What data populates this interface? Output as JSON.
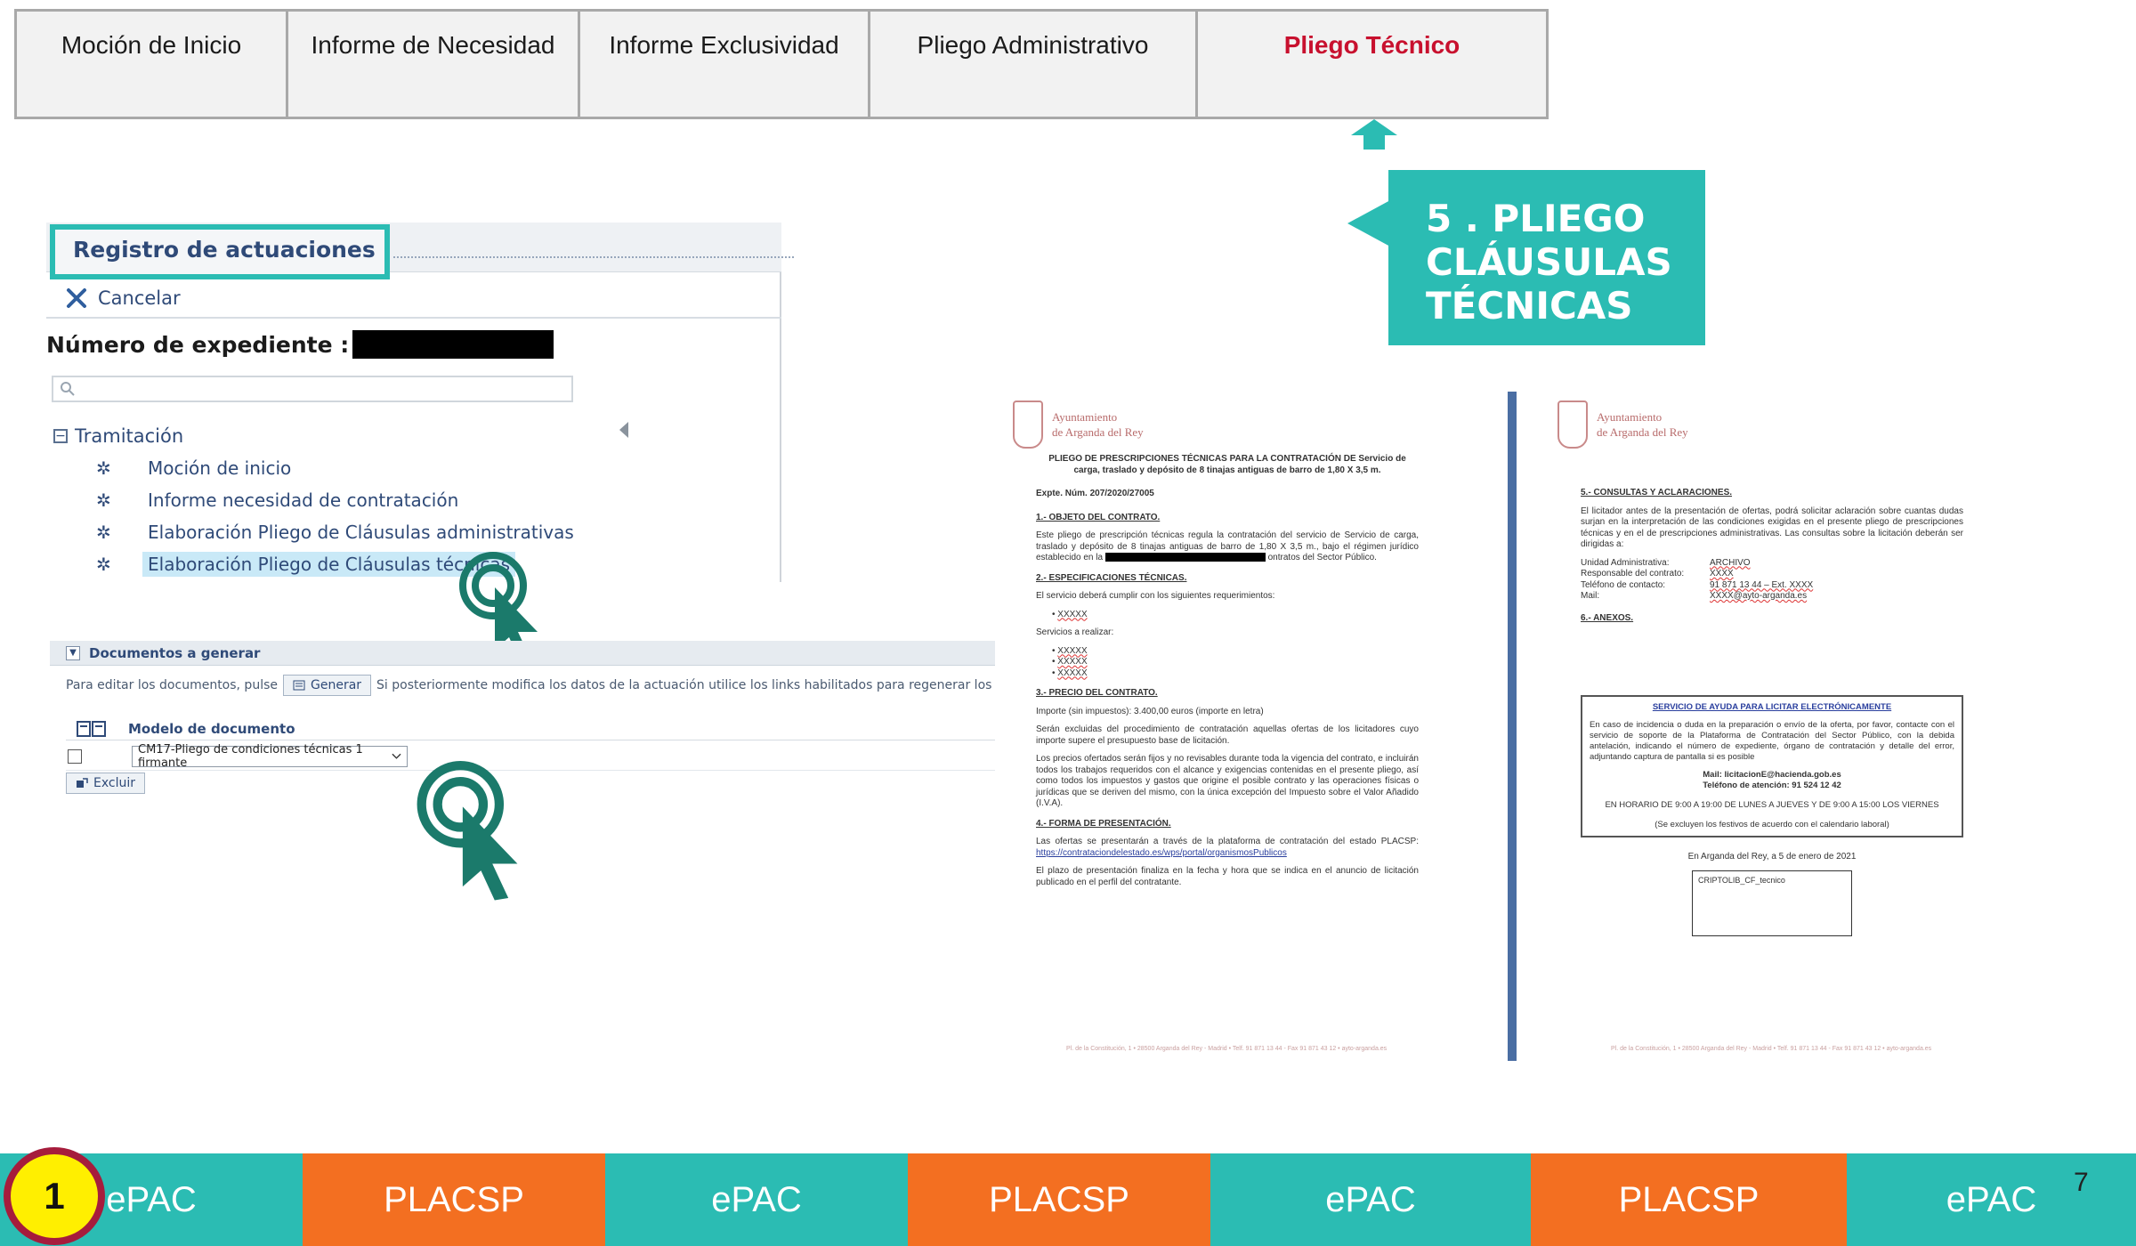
{
  "steps": [
    {
      "label": "Moción de Inicio",
      "active": false
    },
    {
      "label": "Informe de Necesidad",
      "active": false
    },
    {
      "label": "Informe Exclusividad",
      "active": false
    },
    {
      "label": "Pliego Administrativo",
      "active": false
    },
    {
      "label": "Pliego Técnico",
      "active": true
    }
  ],
  "callout": {
    "line1": "5 . PLIEGO",
    "line2": "CLÁUSULAS",
    "line3": "TÉCNICAS",
    "color": "#2bbcb3"
  },
  "registro": {
    "title": "Registro de actuaciones",
    "cancel_label": "Cancelar",
    "expediente_label": "Número de expediente :",
    "search_placeholder": "",
    "tree_root": "Tramitación",
    "tree_items": [
      {
        "label": "Moción de inicio"
      },
      {
        "label": "Informe necesidad de contratación"
      },
      {
        "label": "Elaboración Pliego de Cláusulas administrativas"
      },
      {
        "label": "Elaboración Pliego de Cláusulas técnicas",
        "selected": true
      }
    ]
  },
  "documentos": {
    "header": "Documentos a generar",
    "help_prefix": "Para editar los documentos, pulse",
    "generar_label": "Generar",
    "help_suffix": "Si posteriormente modifica los datos de la actuación utilice los links habilitados para regenerar los documentos",
    "column_header": "Modelo de documento",
    "selected_model": "CM17-Pliego de condiciones técnicas 1 firmante",
    "excluir_label": "Excluir"
  },
  "doc_left": {
    "org_line1": "Ayuntamiento",
    "org_line2": "de Arganda del Rey",
    "title": "PLIEGO DE PRESCRIPCIONES TÉCNICAS PARA LA CONTRATACIÓN DE Servicio de carga, traslado y depósito de 8 tinajas antiguas de barro de 1,80 X 3,5 m.",
    "expte": "Expte. Núm. 207/2020/27005",
    "s1": "1.- OBJETO DEL CONTRATO.",
    "s1_text_a": "Este pliego de prescripción técnicas regula la contratación del servicio de Servicio de carga, traslado y depósito de 8 tinajas antiguas de barro de 1,80 X 3,5 m., bajo el régimen jurídico establecido en la",
    "s1_text_b": "ontratos del Sector Público.",
    "s2": "2.- ESPECIFICACIONES TÉCNICAS.",
    "s2_text": "El servicio deberá cumplir con los siguientes requerimientos:",
    "s2_req": "XXXXX",
    "s2_services_label": "Servicios a realizar:",
    "s2_services": [
      "XXXXX",
      "XXXXX",
      "XXXXX"
    ],
    "s3": "3.- PRECIO DEL CONTRATO.",
    "s3_text": "Importe (sin impuestos): 3.400,00 euros (importe en letra)",
    "s3_p2": "Serán excluidas del procedimiento de contratación aquellas ofertas de los licitadores cuyo importe supere el presupuesto base de licitación.",
    "s3_p3": "Los precios ofertados serán fijos y no revisables durante toda la vigencia del contrato, e incluirán todos los trabajos requeridos con el alcance y exigencias contenidas en el presente pliego, así como todos los impuestos y gastos que origine el posible contrato y las operaciones físicas o jurídicas que se deriven del mismo, con la única excepción del Impuesto sobre el Valor Añadido (I.V.A).",
    "s4": "4.- FORMA DE PRESENTACIÓN.",
    "s4_text": "Las ofertas se presentarán a través de la plataforma de contratación del estado PLACSP:",
    "s4_link": "https://contrataciondelestado.es/wps/portal/organismosPublicos",
    "s4_p2": "El plazo de presentación finaliza en la fecha y hora que se indica en el anuncio de licitación publicado en el perfil del contratante.",
    "footer": "Pl. de la Constitución, 1 • 28500 Arganda del Rey - Madrid • Telf. 91 871 13 44 - Fax 91 871 43 12 • ayto-arganda.es"
  },
  "doc_right": {
    "org_line1": "Ayuntamiento",
    "org_line2": "de Arganda del Rey",
    "s5": "5.- CONSULTAS Y ACLARACIONES.",
    "s5_text": "El licitador antes de la presentación de ofertas, podrá solicitar aclaración sobre cuantas dudas surjan en la interpretación de las condiciones exigidas en el presente pliego de prescripciones técnicas y en el de prescripciones administrativas. Las consultas sobre la licitación deberán ser dirigidas a:",
    "contacts": [
      {
        "k": "Unidad Administrativa:",
        "v": "ARCHIVO"
      },
      {
        "k": "Responsable del contrato:",
        "v": "XXXX"
      },
      {
        "k": "Teléfono de contacto:",
        "v": "91 871 13 44 – Ext. XXXX"
      },
      {
        "k": "Mail:",
        "v": "XXXX@ayto-arganda.es"
      }
    ],
    "s6": "6.- ANEXOS.",
    "help_title": "SERVICIO DE AYUDA PARA LICITAR ELECTRÓNICAMENTE",
    "help_p1": "En caso de incidencia o duda en la preparación o envío de la oferta, por favor, contacte con el servicio de soporte de la Plataforma de Contratación del Sector Público, con la debida antelación, indicando el número de expediente, órgano de contratación y detalle del error, adjuntando captura de pantalla si es posible",
    "help_mail": "Mail: licitacionE@hacienda.gob.es",
    "help_phone": "Teléfono de atención: 91 524 12 42",
    "help_hours": "EN HORARIO DE 9:00 A 19:00 DE LUNES A JUEVES Y DE 9:00 A 15:00 LOS VIERNES",
    "help_note": "(Se excluyen los festivos de acuerdo con el calendario laboral)",
    "date_line": "En Arganda del Rey, a 5 de enero de 2021",
    "cripto": "CRIPTOLIB_CF_tecnico",
    "footer": "Pl. de la Constitución, 1 • 28500 Arganda del Rey - Madrid • Telf. 91 871 13 44 - Fax 91 871 43 12 • ayto-arganda.es"
  },
  "bottom_bar": [
    {
      "label": "ePAC",
      "kind": "epac"
    },
    {
      "label": "PLACSP",
      "kind": "placsp"
    },
    {
      "label": "ePAC",
      "kind": "epac"
    },
    {
      "label": "PLACSP",
      "kind": "placsp"
    },
    {
      "label": "ePAC",
      "kind": "epac"
    },
    {
      "label": "PLACSP",
      "kind": "placsp"
    },
    {
      "label": "ePAC",
      "kind": "epac"
    }
  ],
  "step_badge": "1",
  "page_number": "7",
  "colors": {
    "teal": "#2bbcb3",
    "orange": "#f36f21",
    "active_red": "#c8102e"
  }
}
